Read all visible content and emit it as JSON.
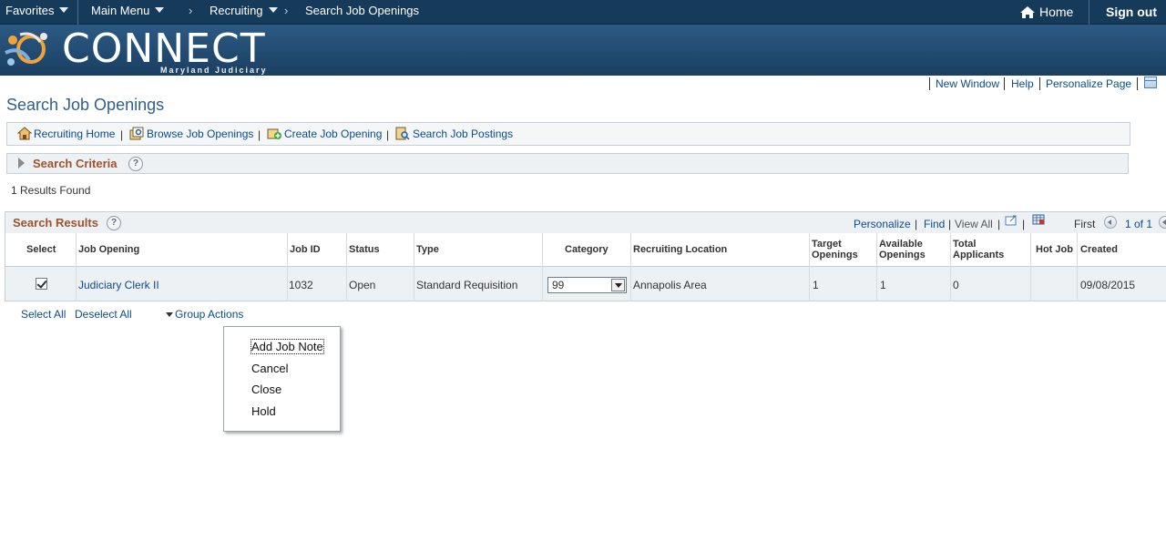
{
  "topnav": {
    "favorites": "Favorites",
    "main_menu": "Main Menu",
    "recruiting": "Recruiting",
    "current_page": "Search Job Openings",
    "home": "Home",
    "sign_out": "Sign out"
  },
  "banner": {
    "logo_text": "CONNECT",
    "logo_sub": "Maryland Judiciary"
  },
  "utility_links": {
    "new_window": "New Window",
    "help": "Help",
    "personalize_page": "Personalize Page"
  },
  "page_title": "Search Job Openings",
  "toolbar": {
    "recruiting_home": "Recruiting Home",
    "browse_job_openings": "Browse Job Openings",
    "create_job_opening": "Create Job Opening",
    "search_job_postings": "Search Job Postings",
    "separator": "|"
  },
  "search_criteria": {
    "label": "Search Criteria",
    "help": "?"
  },
  "results_found": "1 Results Found",
  "results": {
    "title": "Search Results",
    "help": "?",
    "personalize": "Personalize",
    "find": "Find",
    "view_all": "View All",
    "separator": "|",
    "first": "First",
    "paging": "1 of 1",
    "columns": {
      "select": "Select",
      "job_opening": "Job Opening",
      "job_id": "Job ID",
      "status": "Status",
      "type": "Type",
      "category": "Category",
      "recruiting_location": "Recruiting Location",
      "target_openings_1": "Target",
      "target_openings_2": "Openings",
      "available_openings_1": "Available",
      "available_openings_2": "Openings",
      "total_applicants_1": "Total",
      "total_applicants_2": "Applicants",
      "hot_job": "Hot Job",
      "created": "Created"
    },
    "rows": [
      {
        "selected": true,
        "job_opening": "Judiciary Clerk II",
        "job_id": "1032",
        "status": "Open",
        "type": "Standard Requisition",
        "category": "99",
        "recruiting_location": "Annapolis Area",
        "target_openings": "1",
        "available_openings": "1",
        "total_applicants": "0",
        "hot_job": "",
        "created": "09/08/2015"
      }
    ]
  },
  "grid_actions": {
    "select_all": "Select All",
    "deselect_all": "Deselect All",
    "group_actions": "Group Actions"
  },
  "group_actions_menu": [
    "Add Job Note",
    "Cancel",
    "Close",
    "Hold"
  ],
  "colors": {
    "topnav_bg": "#163a5a",
    "link": "#0a4b8f",
    "section_title": "#a0522d",
    "page_title": "#2f5f8f"
  }
}
